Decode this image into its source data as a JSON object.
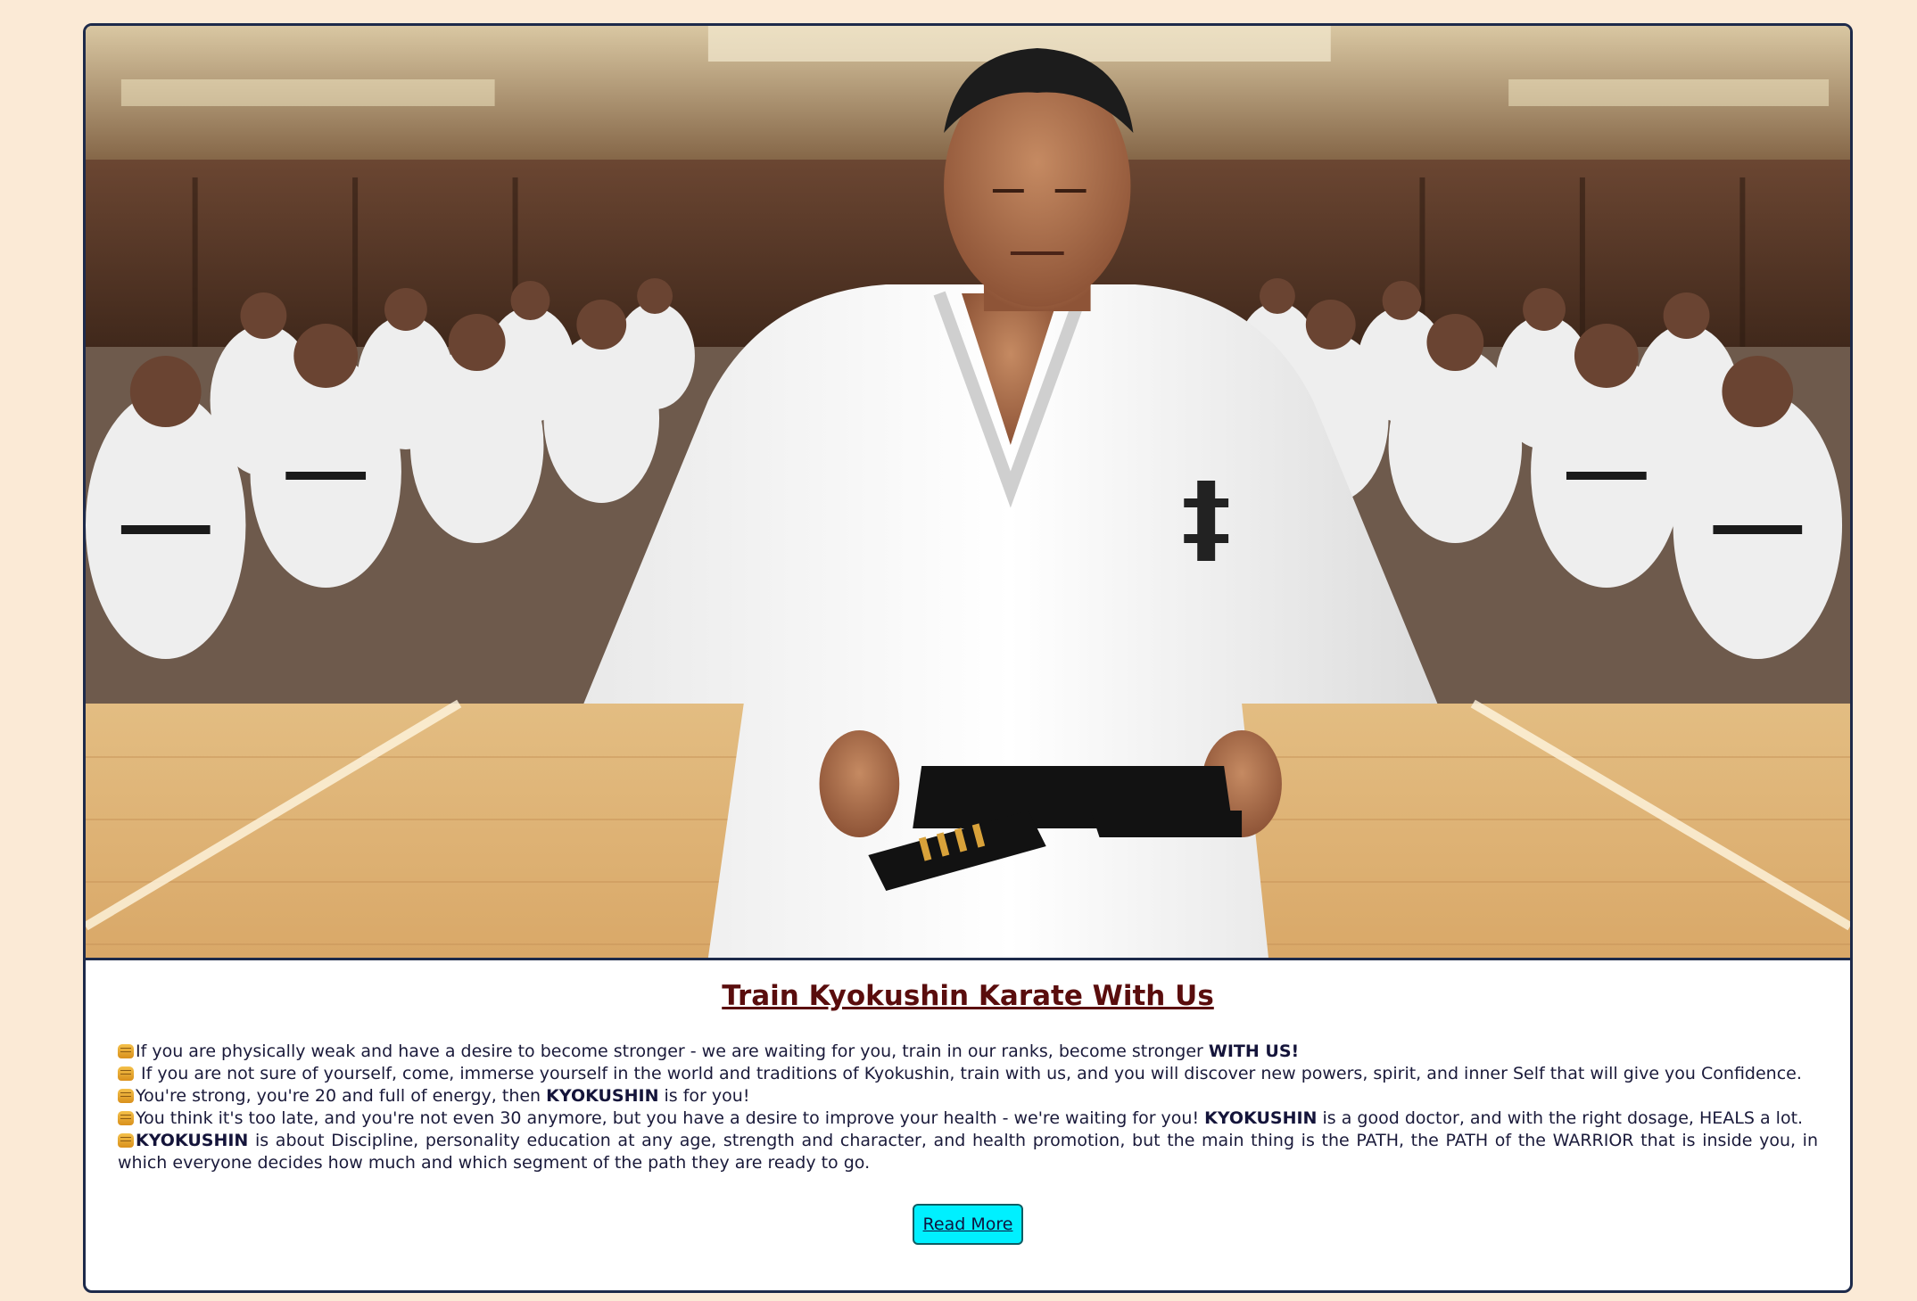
{
  "hero": {
    "image_alt": "Kyokushin karate master kneeling in white gi with black belt in front of rows of seated students"
  },
  "article": {
    "title": "Train Kyokushin Karate With Us",
    "paragraphs": [
      {
        "before": "If you are physically weak and have a desire to become stronger - we are waiting for you, train in our ranks, become stronger ",
        "bold": "WITH US!",
        "after": ""
      },
      {
        "before": " If you are not sure of yourself, come, immerse yourself in the world and traditions of Kyokushin, train with us, and you will discover new powers, spirit, and inner Self that will give you Confidence.",
        "bold": "",
        "after": ""
      },
      {
        "before": "You're strong, you're 20 and full of energy, then ",
        "bold": "KYOKUSHIN",
        "after": " is for you!"
      },
      {
        "before": "You think it's too late, and you're not even 30 anymore, but you have a desire to improve your health - we're waiting for you! ",
        "bold": "KYOKUSHIN",
        "after": " is a good doctor, and with the right dosage, HEALS a lot."
      },
      {
        "before": "",
        "bold": "KYOKUSHIN",
        "after": " is about Discipline, personality education at any age, strength and character, and health promotion, but the main thing is the PATH, the PATH of the WARRIOR that is inside you, in which everyone decides how much and which segment of the path they are ready to go."
      }
    ],
    "read_more_label": "Read More"
  },
  "colors": {
    "page_background": "#fbead6",
    "title": "#5a0d0d",
    "button_background": "#00f0ff",
    "card_border": "#1d2a4a"
  }
}
